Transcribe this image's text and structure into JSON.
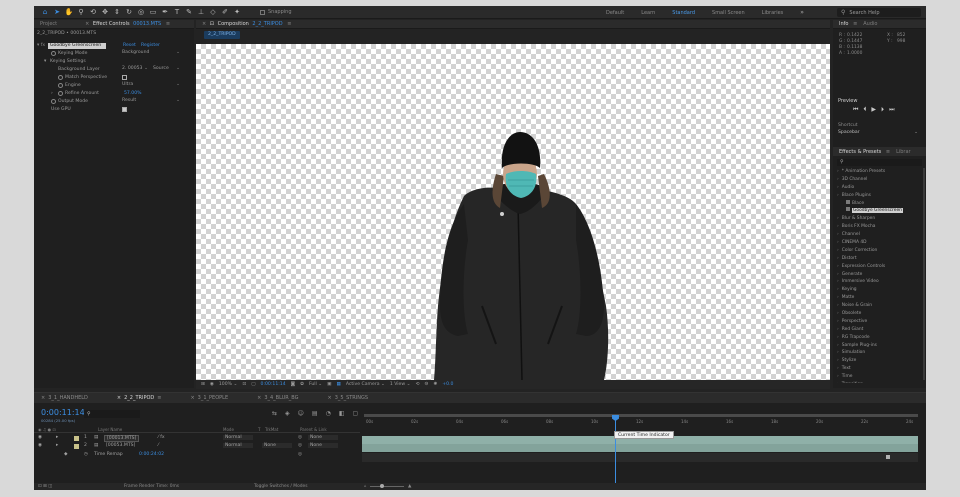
{
  "toolbar": {
    "snapping_label": "Snapping",
    "workspaces": [
      "Default",
      "Learn",
      "Standard",
      "Small Screen",
      "Libraries"
    ],
    "active_workspace": "Standard",
    "more_workspaces": "»",
    "search_help": "Search Help"
  },
  "effect_controls": {
    "tab_project": "Project",
    "tab_label": "Effect Controls",
    "tab_file": "00013.MTS",
    "file_line": "2_2_TRIPOD • 00013.MTS",
    "effect_name": "Goodbye Greenscreen",
    "reset_label": "Reset",
    "register_label": "Register",
    "keying_mode_label": "Keying Mode",
    "keying_mode_value": "Background",
    "keying_settings_label": "Keying Settings",
    "background_layer_label": "Background Layer",
    "background_layer_value": "2. 00053",
    "background_source_value": "Source",
    "match_perspective_label": "Match Perspective",
    "engine_label": "Engine",
    "engine_value": "Ultra",
    "refine_amount_label": "Refine Amount",
    "refine_amount_value": "57.00%",
    "output_mode_label": "Output Mode",
    "output_mode_value": "Result",
    "use_gpu_label": "Use GPU"
  },
  "composition": {
    "tab_label": "Composition",
    "tab_name": "2_2_TRIPOD",
    "breadcrumb": "2_2_TRIPOD",
    "footer": {
      "zoom": "100%",
      "timecode": "0:00:11:14",
      "resolution": "Full",
      "camera": "Active Camera",
      "views": "1 View",
      "exposure": "+0.0"
    }
  },
  "info_panel": {
    "tab_info": "Info",
    "tab_audio": "Audio",
    "r_label": "R :",
    "r_value": "0.1422",
    "g_label": "G :",
    "g_value": "0.1447",
    "b_label": "B :",
    "b_value": "0.1138",
    "a_label": "A :",
    "a_value": "1.0000",
    "x_label": "X :",
    "x_value": "852",
    "y_label": "Y :",
    "y_value": "998"
  },
  "preview_panel": {
    "title": "Preview",
    "shortcut_label": "Shortcut",
    "shortcut_value": "Spacebar"
  },
  "effects_presets": {
    "tab_label": "Effects & Presets",
    "tab_libraries": "Librar",
    "search_value": "",
    "items": [
      {
        "label": "* Animation Presets",
        "sub": false,
        "selected": false
      },
      {
        "label": "3D Channel",
        "sub": false,
        "selected": false
      },
      {
        "label": "Audio",
        "sub": false,
        "selected": false
      },
      {
        "label": "Blace Plugins",
        "sub": false,
        "selected": false
      },
      {
        "label": "Blace",
        "sub": true,
        "selected": false
      },
      {
        "label": "Goodbye Greenscreen",
        "sub": true,
        "selected": true
      },
      {
        "label": "Blur & Sharpen",
        "sub": false,
        "selected": false
      },
      {
        "label": "Boris FX Mocha",
        "sub": false,
        "selected": false
      },
      {
        "label": "Channel",
        "sub": false,
        "selected": false
      },
      {
        "label": "CINEMA 4D",
        "sub": false,
        "selected": false
      },
      {
        "label": "Color Correction",
        "sub": false,
        "selected": false
      },
      {
        "label": "Distort",
        "sub": false,
        "selected": false
      },
      {
        "label": "Expression Controls",
        "sub": false,
        "selected": false
      },
      {
        "label": "Generate",
        "sub": false,
        "selected": false
      },
      {
        "label": "Immersive Video",
        "sub": false,
        "selected": false
      },
      {
        "label": "Keying",
        "sub": false,
        "selected": false
      },
      {
        "label": "Matte",
        "sub": false,
        "selected": false
      },
      {
        "label": "Noise & Grain",
        "sub": false,
        "selected": false
      },
      {
        "label": "Obsolete",
        "sub": false,
        "selected": false
      },
      {
        "label": "Perspective",
        "sub": false,
        "selected": false
      },
      {
        "label": "Red Giant",
        "sub": false,
        "selected": false
      },
      {
        "label": "RG Trapcode",
        "sub": false,
        "selected": false
      },
      {
        "label": "Sample Plug-ins",
        "sub": false,
        "selected": false
      },
      {
        "label": "Simulation",
        "sub": false,
        "selected": false
      },
      {
        "label": "Stylize",
        "sub": false,
        "selected": false
      },
      {
        "label": "Text",
        "sub": false,
        "selected": false
      },
      {
        "label": "Time",
        "sub": false,
        "selected": false
      },
      {
        "label": "Transition",
        "sub": false,
        "selected": false
      }
    ]
  },
  "timeline": {
    "tabs": [
      "3_1_HANDHELD",
      "2_2_TRIPOD",
      "3_1_PEOPLE",
      "3_4_BLUR_BG",
      "3_5_STRINGS"
    ],
    "active_tab": "2_2_TRIPOD",
    "current_time": "0:00:11:14",
    "fps_label": "00284 (25.00 fps)",
    "search_value": "",
    "columns": {
      "layer_name": "Layer Name",
      "mode": "Mode",
      "t": "T",
      "trkmat": "TrkMat",
      "parent": "Parent & Link"
    },
    "layers": [
      {
        "num": "1",
        "name": "[00013.MTS]",
        "mode": "Normal",
        "trkmat": "",
        "parent": "None"
      },
      {
        "num": "2",
        "name": "[00053.MTS]",
        "mode": "Normal",
        "trkmat": "None",
        "parent": "None"
      }
    ],
    "time_remap_label": "Time Remap",
    "time_remap_value": "0:00:24:02",
    "ruler_labels": [
      "00s",
      "02s",
      "04s",
      "06s",
      "08s",
      "10s",
      "12s",
      "14s",
      "16s",
      "18s",
      "20s",
      "22s",
      "24s"
    ],
    "playhead_fraction": 0.455,
    "tooltip": "Current Time Indicator",
    "frame_render_label": "Frame Render Time: 0ms",
    "toggle_label": "Toggle Switches / Modes"
  },
  "colors": {
    "accent": "#3b8de0",
    "bar_layer_1": "#8fb0a8",
    "bar_layer_2": "#83a39b",
    "label_swatch": "#c9c28a"
  }
}
